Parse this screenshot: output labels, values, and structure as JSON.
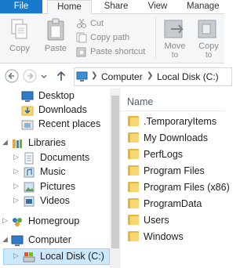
{
  "ribbon": {
    "tabs": [
      "File",
      "Home",
      "Share",
      "View",
      "Manage"
    ],
    "clipboard": {
      "copy": "Copy",
      "paste": "Paste",
      "cut": "Cut",
      "copy_path": "Copy path",
      "paste_shortcut": "Paste shortcut"
    },
    "organize": {
      "move_to": "Move",
      "move_to_sub": "to",
      "copy_to": "Copy",
      "copy_to_sub": "to"
    }
  },
  "address": {
    "crumbs": [
      "Computer",
      "Local Disk (C:)"
    ]
  },
  "navpane": {
    "items": [
      {
        "label": "Desktop",
        "icon": "desktop-icon"
      },
      {
        "label": "Downloads",
        "icon": "downloads-icon"
      },
      {
        "label": "Recent places",
        "icon": "recent-places-icon"
      },
      {
        "label": "Libraries",
        "icon": "libraries-icon"
      },
      {
        "label": "Documents",
        "icon": "documents-icon"
      },
      {
        "label": "Music",
        "icon": "music-icon"
      },
      {
        "label": "Pictures",
        "icon": "pictures-icon"
      },
      {
        "label": "Videos",
        "icon": "videos-icon"
      },
      {
        "label": "Homegroup",
        "icon": "homegroup-icon"
      },
      {
        "label": "Computer",
        "icon": "computer-icon"
      },
      {
        "label": "Local Disk (C:)",
        "icon": "local-disk-icon"
      }
    ]
  },
  "content": {
    "column_header": "Name",
    "files": [
      ".TemporaryItems",
      "My Downloads",
      "PerfLogs",
      "Program Files",
      "Program Files (x86)",
      "ProgramData",
      "Users",
      "Windows"
    ]
  },
  "colors": {
    "file_tab": "#1979ca",
    "selected_nav": "#cce8ff",
    "folder": "#f7d774"
  }
}
